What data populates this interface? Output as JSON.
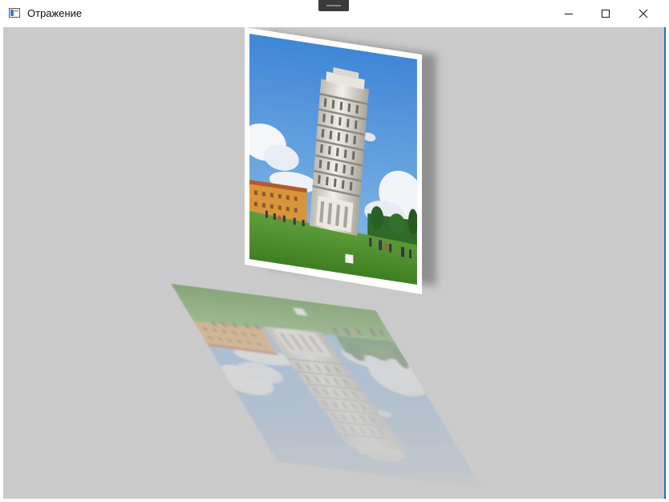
{
  "window": {
    "title": "Отражение"
  },
  "controls": {
    "minimize_icon": "minimize-icon",
    "maximize_icon": "maximize-icon",
    "close_icon": "close-icon"
  },
  "colors": {
    "client_background": "#cacaca",
    "titlebar_background": "#ffffff",
    "accent_edge": "#2b6fb5"
  },
  "scene": {
    "photo_subject": "leaning-tower-photo",
    "reflection_subject": "leaning-tower-reflection"
  }
}
